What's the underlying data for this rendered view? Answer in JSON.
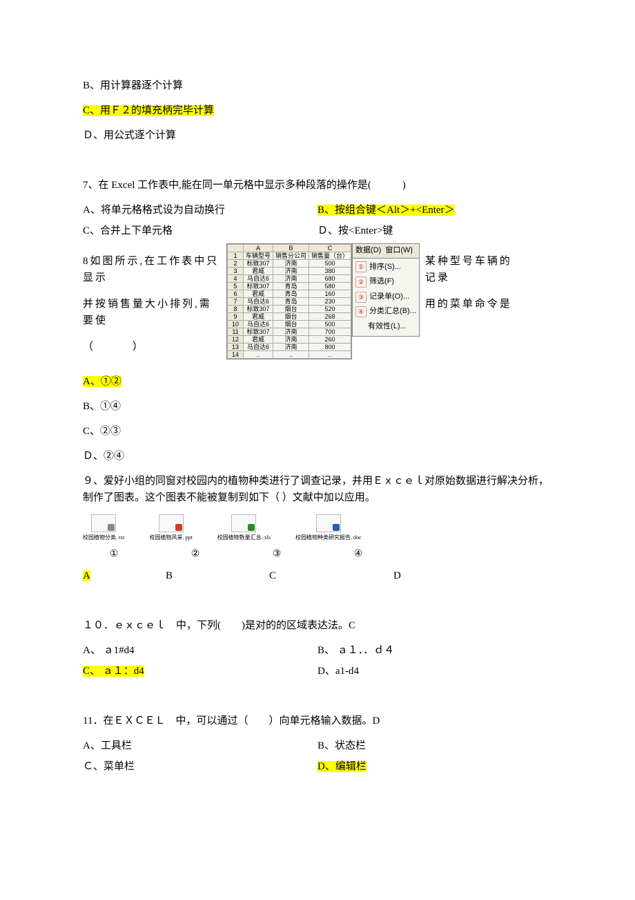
{
  "lines": {
    "optB_calc": "B、用计算器逐个计算",
    "optC_f2": "C、用Ｆ２的填充柄完毕计算",
    "optD_formula": "Ｄ、用公式逐个计算",
    "q7": "7、在 Excel 工作表中,能在同一单元格中显示多种段落的操作是(　　　)",
    "q7_A": "A、将单元格格式设为自动换行",
    "q7_B": "B、按组合键＜Alt＞+<Enter＞",
    "q7_C": "C、合并上下单元格",
    "q7_D": "Ｄ、按<Enter>键",
    "q8_part1": "8如图所示,在工作表中只显示",
    "q8_part2": "并按销售量大小排列,需要使",
    "q8_part3": "（　　　）",
    "q8_right1": "某种型号车辆的记录",
    "q8_right2": "用的菜单命令是",
    "q8_A": "A、①②",
    "q8_B": "B、①④",
    "q8_C": "C、②③",
    "q8_D": "Ｄ、②④",
    "q9": "９、爱好小组的同窗对校园内的植物种类进行了调查记录，并用Ｅｘｃｅｌ对原始数据进行解决分析，制作了图表。这个图表不能被复制到如下（  ）文献中加以应用。",
    "file1": "校园植物分类. txt",
    "file2": "校园植物风采. ppt",
    "file3": "校园植物数量汇总. xls",
    "file4": "校园植物种类研究报告. doc",
    "num1": "①",
    "num2": "②",
    "num3": "③",
    "num4": "④",
    "q9_A": "A",
    "q9_B": "B",
    "q9_C": "C",
    "q9_D": "D",
    "q10": "１０．ｅｘｃｅｌ　中，下列(　　)是对的的区域表达法。C",
    "q10_A": "A、 ａ1#d4",
    "q10_B": "B、 ａ１．．ｄ４",
    "q10_C": "C、 ａ１：d4",
    "q10_D": "D、a1-d4",
    "q11": "11．在ＥＸＣＥＬ　中，可以通过（　　）向单元格输入数据。D",
    "q11_A": "A、工具栏",
    "q11_B": "B、状态栏",
    "q11_C": "Ｃ、菜单栏",
    "q11_D": "D、编辑栏"
  },
  "table": {
    "headers": [
      "",
      "A",
      "B",
      "C"
    ],
    "rows": [
      [
        "1",
        "车辆型号",
        "销售分公司",
        "销售量（台）"
      ],
      [
        "2",
        "标致307",
        "济南",
        "500"
      ],
      [
        "3",
        "君威",
        "济南",
        "380"
      ],
      [
        "4",
        "马自达6",
        "济南",
        "680"
      ],
      [
        "5",
        "标致307",
        "青岛",
        "580"
      ],
      [
        "6",
        "君威",
        "青岛",
        "160"
      ],
      [
        "7",
        "马自达6",
        "青岛",
        "230"
      ],
      [
        "8",
        "标致307",
        "烟台",
        "520"
      ],
      [
        "9",
        "君威",
        "烟台",
        "268"
      ],
      [
        "10",
        "马自达6",
        "烟台",
        "500"
      ],
      [
        "11",
        "标致307",
        "济南",
        "700"
      ],
      [
        "12",
        "君威",
        "济南",
        "260"
      ],
      [
        "13",
        "马自达6",
        "济南",
        "800"
      ],
      [
        "14",
        "‥",
        "‥",
        "‥"
      ]
    ]
  },
  "menu": {
    "header1": "数据(D)",
    "header2": "窗口(W)",
    "items": [
      {
        "n": "①",
        "t": "排序(S)..."
      },
      {
        "n": "②",
        "t": "筛选(F)"
      },
      {
        "n": "③",
        "t": "记录单(O)..."
      },
      {
        "n": "④",
        "t": "分类汇总(B)..."
      },
      {
        "n": "",
        "t": "有效性(L)..."
      }
    ]
  }
}
